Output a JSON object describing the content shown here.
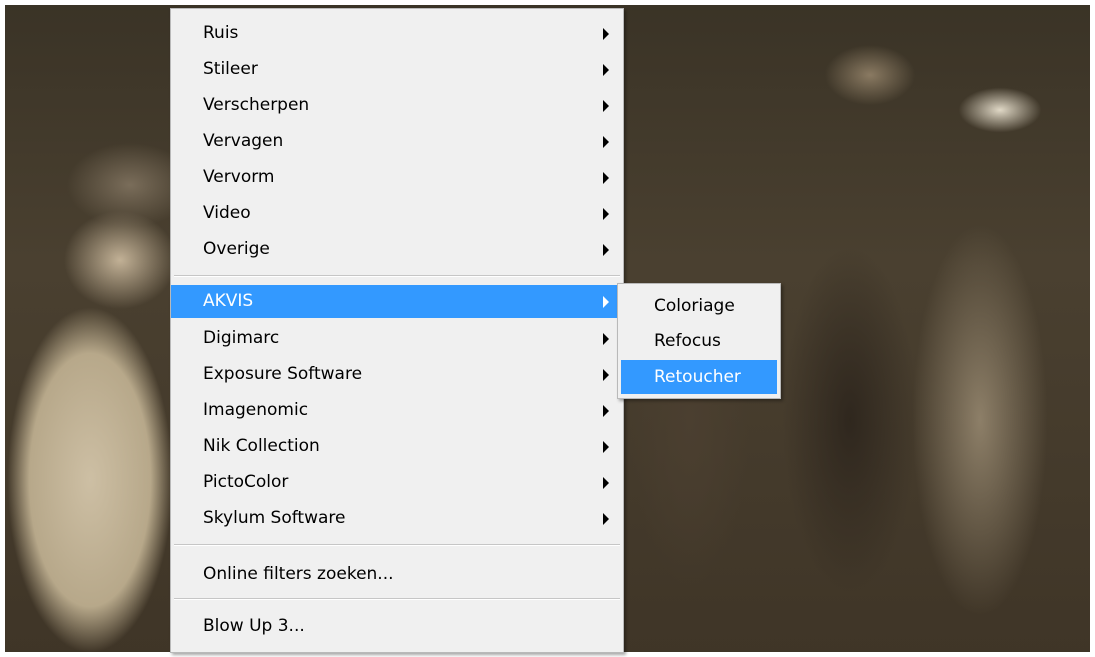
{
  "menu": {
    "items": [
      {
        "label": "Ruis",
        "has_submenu": true
      },
      {
        "label": "Stileer",
        "has_submenu": true
      },
      {
        "label": "Verscherpen",
        "has_submenu": true
      },
      {
        "label": "Vervagen",
        "has_submenu": true
      },
      {
        "label": "Vervorm",
        "has_submenu": true
      },
      {
        "label": "Video",
        "has_submenu": true
      },
      {
        "label": "Overige",
        "has_submenu": true
      },
      {
        "label": "AKVIS",
        "has_submenu": true,
        "highlighted": true
      },
      {
        "label": "Digimarc",
        "has_submenu": true
      },
      {
        "label": "Exposure Software",
        "has_submenu": true
      },
      {
        "label": "Imagenomic",
        "has_submenu": true
      },
      {
        "label": "Nik Collection",
        "has_submenu": true
      },
      {
        "label": "PictoColor",
        "has_submenu": true
      },
      {
        "label": "Skylum Software",
        "has_submenu": true
      },
      {
        "label": "Online filters zoeken...",
        "has_submenu": false
      },
      {
        "label": "Blow Up 3...",
        "has_submenu": false
      }
    ]
  },
  "submenu": {
    "parent": "AKVIS",
    "items": [
      {
        "label": "Coloriage"
      },
      {
        "label": "Refocus"
      },
      {
        "label": "Retoucher",
        "highlighted": true
      }
    ]
  },
  "colors": {
    "menu_background": "#f0f0f0",
    "highlight": "#3399ff",
    "highlight_text": "#ffffff",
    "text": "#000000"
  },
  "icons": {
    "submenu_arrow": "chevron-right-icon"
  }
}
